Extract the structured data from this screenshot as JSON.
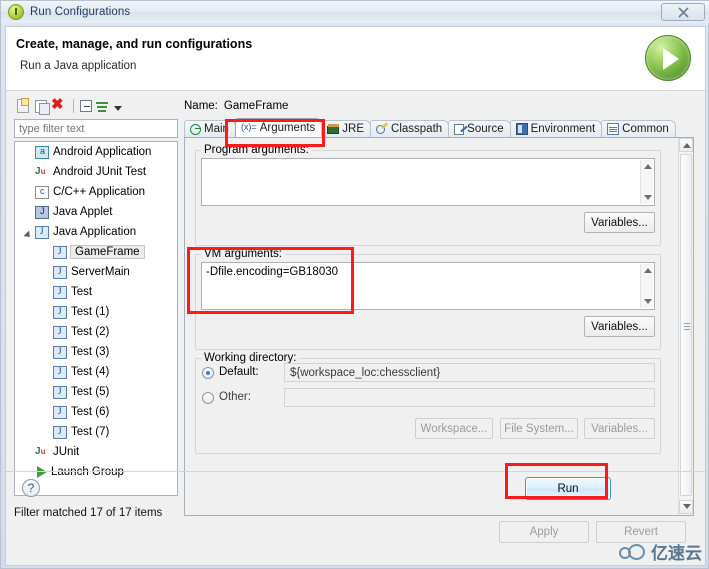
{
  "window": {
    "title": "Run Configurations",
    "close_label": "✕",
    "icon": "eclipse-run-icon"
  },
  "header": {
    "title": "Create, manage, and run configurations",
    "subtitle": "Run a Java application",
    "icon": "green-play-icon"
  },
  "tree_toolbar": {
    "buttons": [
      {
        "name": "new-configuration-button",
        "icon": "new-document-icon"
      },
      {
        "name": "duplicate-configuration-button",
        "icon": "duplicate-icon"
      },
      {
        "name": "delete-configuration-button",
        "icon": "red-delete-x-icon"
      },
      {
        "name": "collapse-all-button",
        "icon": "collapse-all-icon"
      },
      {
        "name": "filter-button",
        "icon": "filter-icon"
      },
      {
        "name": "view-menu-button",
        "icon": "chevron-down-icon"
      }
    ]
  },
  "filter": {
    "placeholder": "type filter text",
    "value": ""
  },
  "tree": {
    "items": [
      {
        "label": "Android Application",
        "icon": "android-icon",
        "indent": 0,
        "arrow": "none",
        "selected": false
      },
      {
        "label": "Android JUnit Test",
        "icon": "android-junit-icon",
        "indent": 0,
        "arrow": "none",
        "selected": false
      },
      {
        "label": "C/C++ Application",
        "icon": "c-cpp-icon",
        "indent": 0,
        "arrow": "none",
        "selected": false
      },
      {
        "label": "Java Applet",
        "icon": "java-applet-icon",
        "indent": 0,
        "arrow": "none",
        "selected": false
      },
      {
        "label": "Java Application",
        "icon": "java-icon",
        "indent": 0,
        "arrow": "expanded",
        "selected": false
      },
      {
        "label": "GameFrame",
        "icon": "java-icon",
        "indent": 1,
        "arrow": "none",
        "selected": true
      },
      {
        "label": "ServerMain",
        "icon": "java-icon",
        "indent": 1,
        "arrow": "none",
        "selected": false
      },
      {
        "label": "Test",
        "icon": "java-icon",
        "indent": 1,
        "arrow": "none",
        "selected": false
      },
      {
        "label": "Test (1)",
        "icon": "java-icon",
        "indent": 1,
        "arrow": "none",
        "selected": false
      },
      {
        "label": "Test (2)",
        "icon": "java-icon",
        "indent": 1,
        "arrow": "none",
        "selected": false
      },
      {
        "label": "Test (3)",
        "icon": "java-icon",
        "indent": 1,
        "arrow": "none",
        "selected": false
      },
      {
        "label": "Test (4)",
        "icon": "java-icon",
        "indent": 1,
        "arrow": "none",
        "selected": false
      },
      {
        "label": "Test (5)",
        "icon": "java-icon",
        "indent": 1,
        "arrow": "none",
        "selected": false
      },
      {
        "label": "Test (6)",
        "icon": "java-icon",
        "indent": 1,
        "arrow": "none",
        "selected": false
      },
      {
        "label": "Test (7)",
        "icon": "java-icon",
        "indent": 1,
        "arrow": "none",
        "selected": false
      },
      {
        "label": "JUnit",
        "icon": "junit-icon",
        "indent": 0,
        "arrow": "none",
        "selected": false
      },
      {
        "label": "Launch Group",
        "icon": "launch-group-icon",
        "indent": 0,
        "arrow": "none",
        "selected": false
      }
    ],
    "status": "Filter matched 17 of 17 items"
  },
  "config": {
    "name_label": "Name:",
    "name_value": "GameFrame"
  },
  "tabs": [
    {
      "label": "Main",
      "icon": "main-tab-icon",
      "active": false
    },
    {
      "label": "Arguments",
      "icon": "arguments-tab-icon",
      "active": true
    },
    {
      "label": "JRE",
      "icon": "jre-tab-icon",
      "active": false
    },
    {
      "label": "Classpath",
      "icon": "classpath-tab-icon",
      "active": false
    },
    {
      "label": "Source",
      "icon": "source-tab-icon",
      "active": false
    },
    {
      "label": "Environment",
      "icon": "environment-tab-icon",
      "active": false
    },
    {
      "label": "Common",
      "icon": "common-tab-icon",
      "active": false
    }
  ],
  "arguments_tab": {
    "program_arguments": {
      "label": "Program arguments:",
      "value": "",
      "variables_button": "Variables..."
    },
    "vm_arguments": {
      "label": "VM arguments:",
      "value": "-Dfile.encoding=GB18030",
      "variables_button": "Variables..."
    },
    "working_directory": {
      "label": "Working directory:",
      "default_label": "Default:",
      "default_value": "${workspace_loc:chessclient}",
      "default_selected": true,
      "other_label": "Other:",
      "other_value": "",
      "other_selected": false,
      "workspace_button": "Workspace...",
      "file_system_button": "File System...",
      "variables_button": "Variables..."
    }
  },
  "footer": {
    "apply_label": "Apply",
    "revert_label": "Revert",
    "run_label": "Run",
    "help_label": "?"
  },
  "watermark": {
    "text": "亿速云",
    "icon": "cloud-icon"
  },
  "colors": {
    "annotation_red": "#ff1a1a",
    "accent_green": "#5c9b2d",
    "run_button_border": "#3c9ad1",
    "title_text": "#1b3a5c"
  },
  "annotations": [
    {
      "name": "annotation-arguments-tab"
    },
    {
      "name": "annotation-vm-arguments"
    },
    {
      "name": "annotation-apply-button"
    }
  ]
}
